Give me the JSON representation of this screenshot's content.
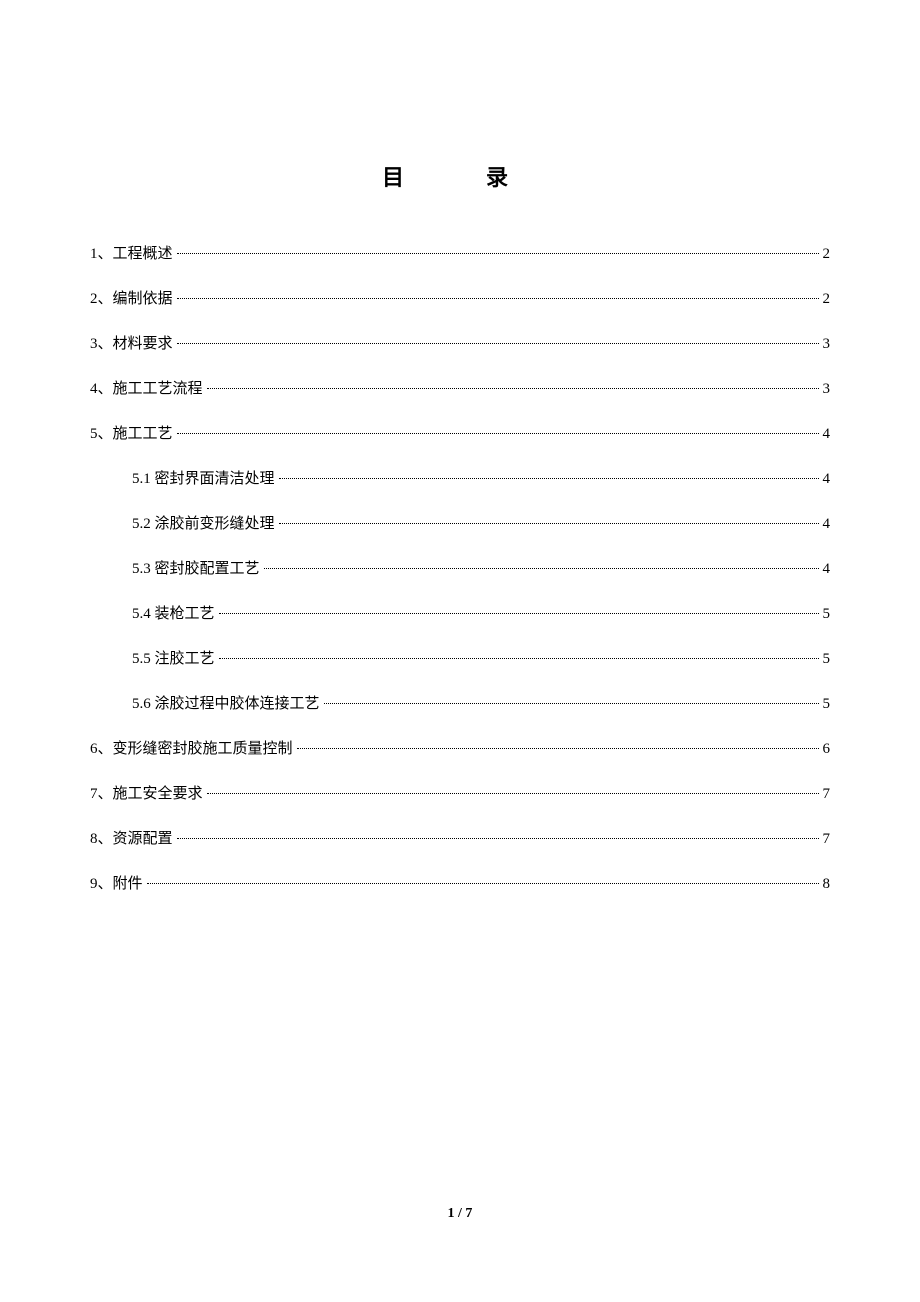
{
  "title": "目　录",
  "toc": [
    {
      "label": "1、工程概述",
      "page": "2",
      "sub": false
    },
    {
      "label": "2、编制依据",
      "page": "2",
      "sub": false
    },
    {
      "label": "3、材料要求",
      "page": "3",
      "sub": false
    },
    {
      "label": "4、施工工艺流程",
      "page": "3",
      "sub": false
    },
    {
      "label": "5、施工工艺",
      "page": "4",
      "sub": false
    },
    {
      "label": "5.1 密封界面清洁处理",
      "page": "4",
      "sub": true
    },
    {
      "label": "5.2 涂胶前变形缝处理",
      "page": "4",
      "sub": true
    },
    {
      "label": "5.3 密封胶配置工艺",
      "page": "4",
      "sub": true
    },
    {
      "label": "5.4 装枪工艺",
      "page": "5",
      "sub": true
    },
    {
      "label": "5.5 注胶工艺",
      "page": "5",
      "sub": true
    },
    {
      "label": "5.6 涂胶过程中胶体连接工艺",
      "page": "5",
      "sub": true
    },
    {
      "label": "6、变形缝密封胶施工质量控制",
      "page": "6",
      "sub": false
    },
    {
      "label": "7、施工安全要求",
      "page": "7",
      "sub": false
    },
    {
      "label": "8、资源配置",
      "page": "7",
      "sub": false
    },
    {
      "label": "9、附件",
      "page": "8",
      "sub": false
    }
  ],
  "footer": "1 / 7"
}
